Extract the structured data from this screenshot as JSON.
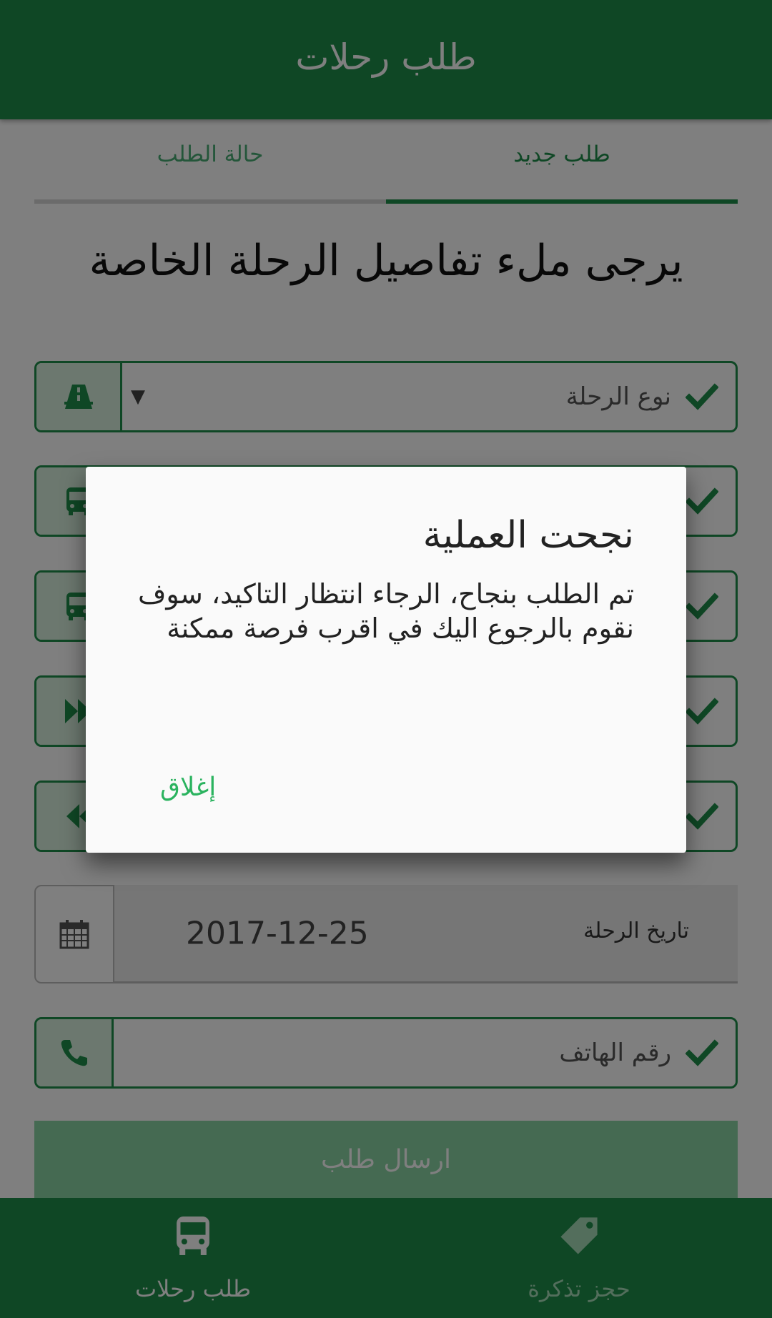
{
  "app": {
    "title": "طلب رحلات"
  },
  "tabs": [
    {
      "label": "طلب جديد",
      "active": true
    },
    {
      "label": "حالة الطلب",
      "active": false
    }
  ],
  "form": {
    "heading": "يرجى ملء تفاصيل الرحلة الخاصة",
    "trip_type": {
      "label": "نوع الرحلة",
      "icon": "road-icon"
    },
    "field2": {
      "icon": "bus-icon"
    },
    "field3": {
      "icon": "bus-icon"
    },
    "field4": {
      "icon": "fast-forward-icon"
    },
    "field5": {
      "icon": "rewind-icon"
    },
    "trip_date": {
      "label": "تاريخ الرحلة",
      "value": "2017-12-25",
      "icon": "calendar-icon"
    },
    "phone": {
      "placeholder": "رقم الهاتف",
      "icon": "phone-icon"
    },
    "submit_label": "ارسال طلب"
  },
  "dialog": {
    "title": "نجحت العملية",
    "message": "تم الطلب بنجاح، الرجاء انتظار التاكيد، سوف نقوم بالرجوع اليك في اقرب فرصة ممكنة",
    "close_label": "إغلاق"
  },
  "bottom_nav": [
    {
      "label": "طلب رحلات",
      "icon": "bus-icon",
      "active": true
    },
    {
      "label": "حجز تذكرة",
      "icon": "tag-icon",
      "active": false
    }
  ],
  "colors": {
    "primary": "#1f8f4b",
    "accent": "#2bb35f",
    "field_icon_bg": "#d8f0df",
    "submit_bg": "#8bd4a4"
  }
}
